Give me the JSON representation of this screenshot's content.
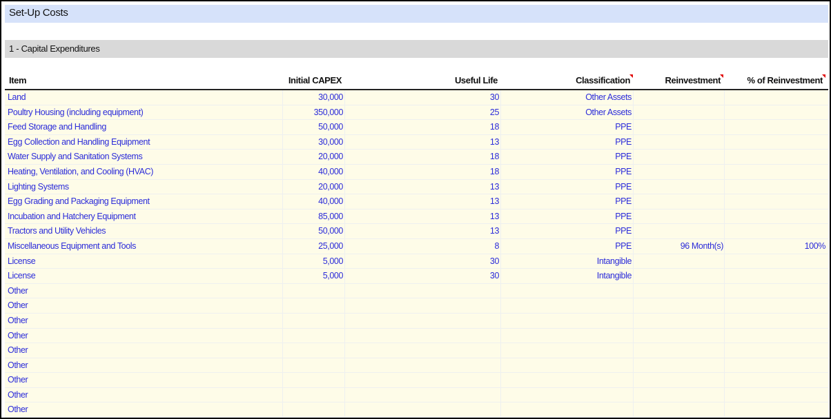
{
  "sheet": {
    "title": "Set-Up Costs",
    "section": "1 - Capital Expenditures"
  },
  "columns": {
    "item": "Item",
    "capex": "Initial CAPEX",
    "life": "Useful Life",
    "classification": "Classification",
    "reinvestment": "Reinvestment",
    "pct_reinvestment": "% of Reinvestment"
  },
  "comment_indicator_color": "#e00000",
  "rows": [
    {
      "item": "Land",
      "capex": "30,000",
      "life": "30",
      "classification": "Other Assets",
      "reinvestment": "",
      "pct": ""
    },
    {
      "item": "Poultry Housing (including equipment)",
      "capex": "350,000",
      "life": "25",
      "classification": "Other Assets",
      "reinvestment": "",
      "pct": ""
    },
    {
      "item": "Feed Storage and Handling",
      "capex": "50,000",
      "life": "18",
      "classification": "PPE",
      "reinvestment": "",
      "pct": ""
    },
    {
      "item": "Egg Collection and Handling Equipment",
      "capex": "30,000",
      "life": "13",
      "classification": "PPE",
      "reinvestment": "",
      "pct": ""
    },
    {
      "item": "Water Supply and Sanitation Systems",
      "capex": "20,000",
      "life": "18",
      "classification": "PPE",
      "reinvestment": "",
      "pct": ""
    },
    {
      "item": "Heating, Ventilation, and Cooling (HVAC)",
      "capex": "40,000",
      "life": "18",
      "classification": "PPE",
      "reinvestment": "",
      "pct": ""
    },
    {
      "item": "Lighting Systems",
      "capex": "20,000",
      "life": "13",
      "classification": "PPE",
      "reinvestment": "",
      "pct": ""
    },
    {
      "item": "Egg Grading and Packaging Equipment",
      "capex": "40,000",
      "life": "13",
      "classification": "PPE",
      "reinvestment": "",
      "pct": ""
    },
    {
      "item": "Incubation and Hatchery Equipment",
      "capex": "85,000",
      "life": "13",
      "classification": "PPE",
      "reinvestment": "",
      "pct": ""
    },
    {
      "item": "Tractors and Utility Vehicles",
      "capex": "50,000",
      "life": "13",
      "classification": "PPE",
      "reinvestment": "",
      "pct": ""
    },
    {
      "item": "Miscellaneous Equipment and Tools",
      "capex": "25,000",
      "life": "8",
      "classification": "PPE",
      "reinvestment": "96 Month(s)",
      "pct": "100%"
    },
    {
      "item": "License",
      "capex": "5,000",
      "life": "30",
      "classification": "Intangible",
      "reinvestment": "",
      "pct": ""
    },
    {
      "item": "License",
      "capex": "5,000",
      "life": "30",
      "classification": "Intangible",
      "reinvestment": "",
      "pct": ""
    },
    {
      "item": "Other",
      "capex": "",
      "life": "",
      "classification": "",
      "reinvestment": "",
      "pct": ""
    },
    {
      "item": "Other",
      "capex": "",
      "life": "",
      "classification": "",
      "reinvestment": "",
      "pct": ""
    },
    {
      "item": "Other",
      "capex": "",
      "life": "",
      "classification": "",
      "reinvestment": "",
      "pct": ""
    },
    {
      "item": "Other",
      "capex": "",
      "life": "",
      "classification": "",
      "reinvestment": "",
      "pct": ""
    },
    {
      "item": "Other",
      "capex": "",
      "life": "",
      "classification": "",
      "reinvestment": "",
      "pct": ""
    },
    {
      "item": "Other",
      "capex": "",
      "life": "",
      "classification": "",
      "reinvestment": "",
      "pct": ""
    },
    {
      "item": "Other",
      "capex": "",
      "life": "",
      "classification": "",
      "reinvestment": "",
      "pct": ""
    },
    {
      "item": "Other",
      "capex": "",
      "life": "",
      "classification": "",
      "reinvestment": "",
      "pct": ""
    },
    {
      "item": "Other",
      "capex": "",
      "life": "",
      "classification": "",
      "reinvestment": "",
      "pct": ""
    }
  ]
}
